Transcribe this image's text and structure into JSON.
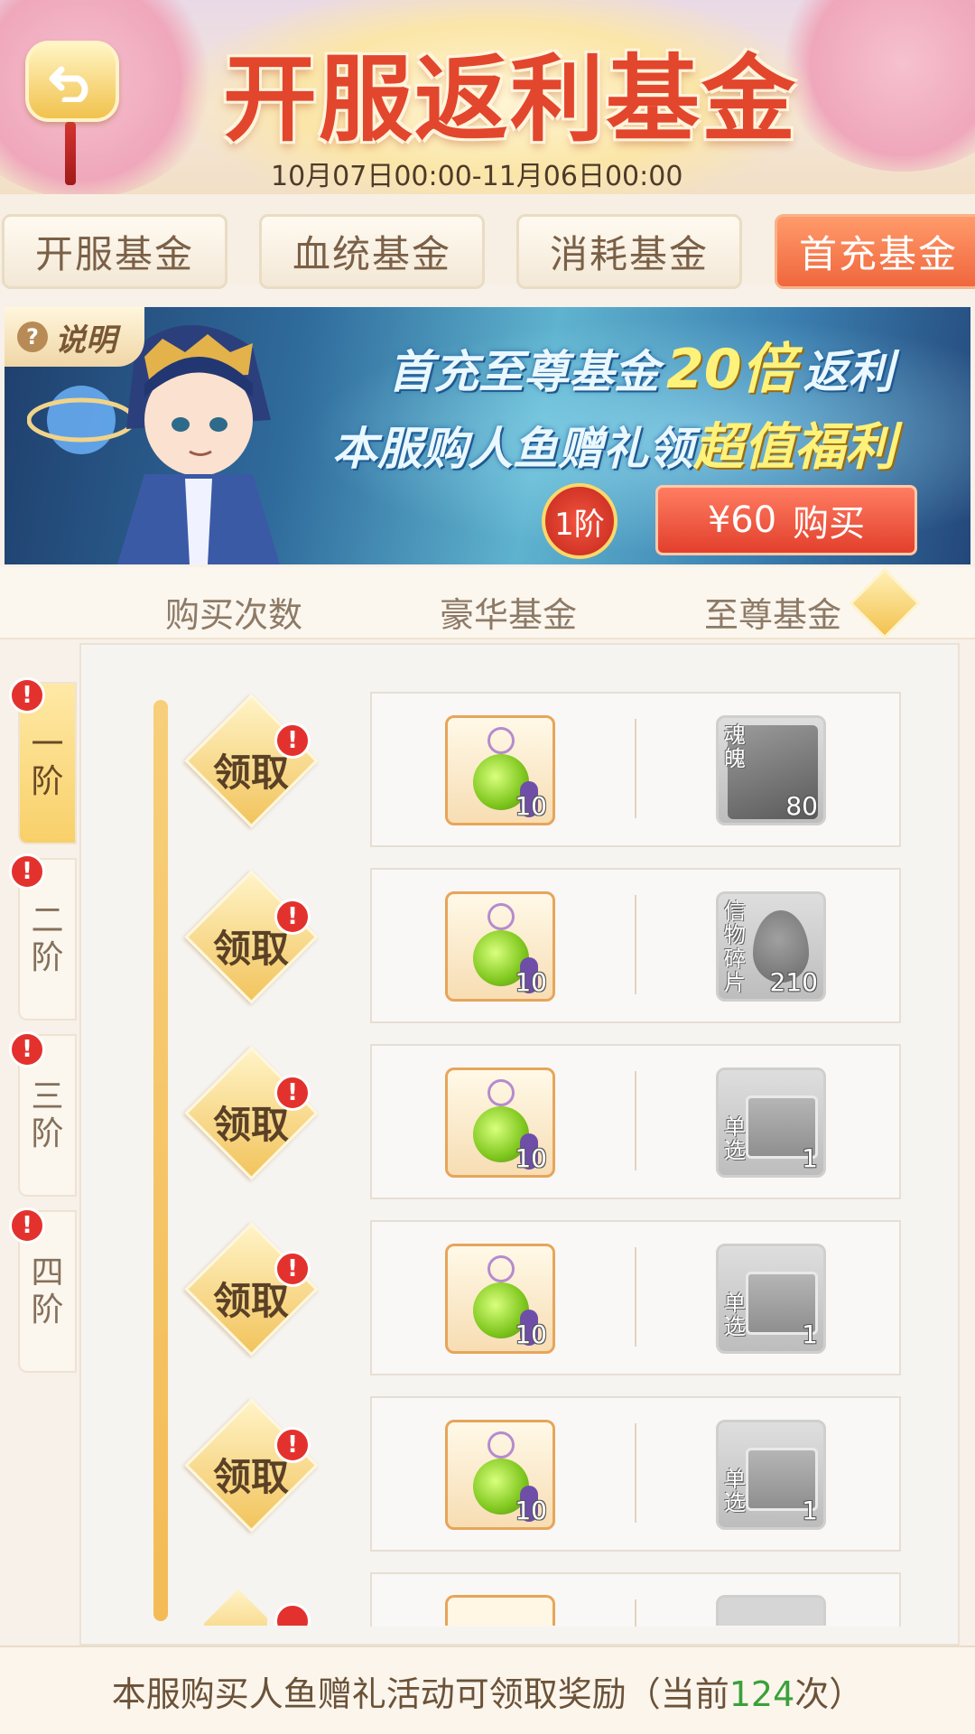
{
  "header": {
    "title": "开服返利基金",
    "date_range": "10月07日00:00-11月06日00:00"
  },
  "tabs": [
    {
      "label": "开服基金"
    },
    {
      "label": "血统基金"
    },
    {
      "label": "消耗基金"
    },
    {
      "label": "首充基金"
    }
  ],
  "banner": {
    "help_label": "说明",
    "help_icon_glyph": "?",
    "line1_prefix": "首充至尊基金",
    "line1_highlight": "20倍",
    "line1_suffix": "返利",
    "line2_prefix": "本服购人鱼赠礼领",
    "line2_highlight": "超值福利",
    "tier_badge": "1阶",
    "price": "¥60",
    "buy_label": "购买"
  },
  "columns": {
    "col1": "购买次数",
    "col2": "豪华基金",
    "col3": "至尊基金"
  },
  "sidebar": [
    {
      "label_top": "一",
      "label_bottom": "阶"
    },
    {
      "label_top": "二",
      "label_bottom": "阶"
    },
    {
      "label_top": "三",
      "label_bottom": "阶"
    },
    {
      "label_top": "四",
      "label_bottom": "阶"
    }
  ],
  "alert_glyph": "!",
  "rows": [
    {
      "claim": "领取",
      "deluxe_qty": "10",
      "supreme_label": "魂魄",
      "supreme_qty": "80"
    },
    {
      "claim": "领取",
      "deluxe_qty": "10",
      "supreme_label": "信物碎片",
      "supreme_qty": "210"
    },
    {
      "claim": "领取",
      "deluxe_qty": "10",
      "supreme_label": "单选",
      "supreme_qty": "1"
    },
    {
      "claim": "领取",
      "deluxe_qty": "10",
      "supreme_label": "单选",
      "supreme_qty": "1"
    },
    {
      "claim": "领取",
      "deluxe_qty": "10",
      "supreme_label": "单选",
      "supreme_qty": "1"
    }
  ],
  "footer": {
    "prefix": "本服购买人鱼赠礼活动可领取奖励（当前",
    "count": "124",
    "suffix": "次）"
  },
  "colors": {
    "accent": "#f0673d",
    "alert": "#e3322e",
    "count_green": "#3aa13a"
  }
}
